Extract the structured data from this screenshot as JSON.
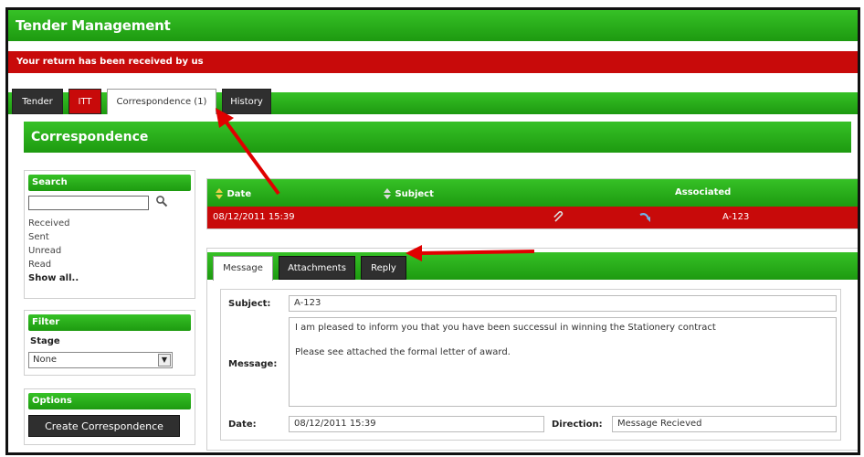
{
  "app": {
    "title": "Tender Management"
  },
  "alert": {
    "message": "Your return has been received by us"
  },
  "tabs": [
    {
      "label": "Tender"
    },
    {
      "label": "ITT"
    },
    {
      "label": "Correspondence (1)"
    },
    {
      "label": "History"
    }
  ],
  "section": {
    "title": "Correspondence"
  },
  "search": {
    "title": "Search",
    "value": "",
    "links": [
      "Received",
      "Sent",
      "Unread",
      "Read"
    ],
    "show_all": "Show all.."
  },
  "filter": {
    "title": "Filter",
    "stage_label": "Stage",
    "stage_value": "None"
  },
  "options": {
    "title": "Options",
    "create_label": "Create Correspondence"
  },
  "grid": {
    "columns": {
      "date": "Date",
      "subject": "Subject",
      "associated": "Associated"
    },
    "rows": [
      {
        "date": "08/12/2011 15:39",
        "associated": "A-123"
      }
    ]
  },
  "detail_tabs": [
    {
      "label": "Message"
    },
    {
      "label": "Attachments"
    },
    {
      "label": "Reply"
    }
  ],
  "message": {
    "subject_label": "Subject:",
    "subject": "A-123",
    "message_label": "Message:",
    "body_line1": "I am pleased to inform you that you have been successul in winning the Stationery contract",
    "body_line2": "Please see attached the formal letter of award.",
    "date_label": "Date:",
    "date": "08/12/2011 15:39",
    "direction_label": "Direction:",
    "direction": "Message Recieved"
  },
  "colors": {
    "green": "#2aae1b",
    "red": "#c80a0a",
    "dark": "#2f2f2f",
    "annotation_arrow": "#e00000"
  }
}
